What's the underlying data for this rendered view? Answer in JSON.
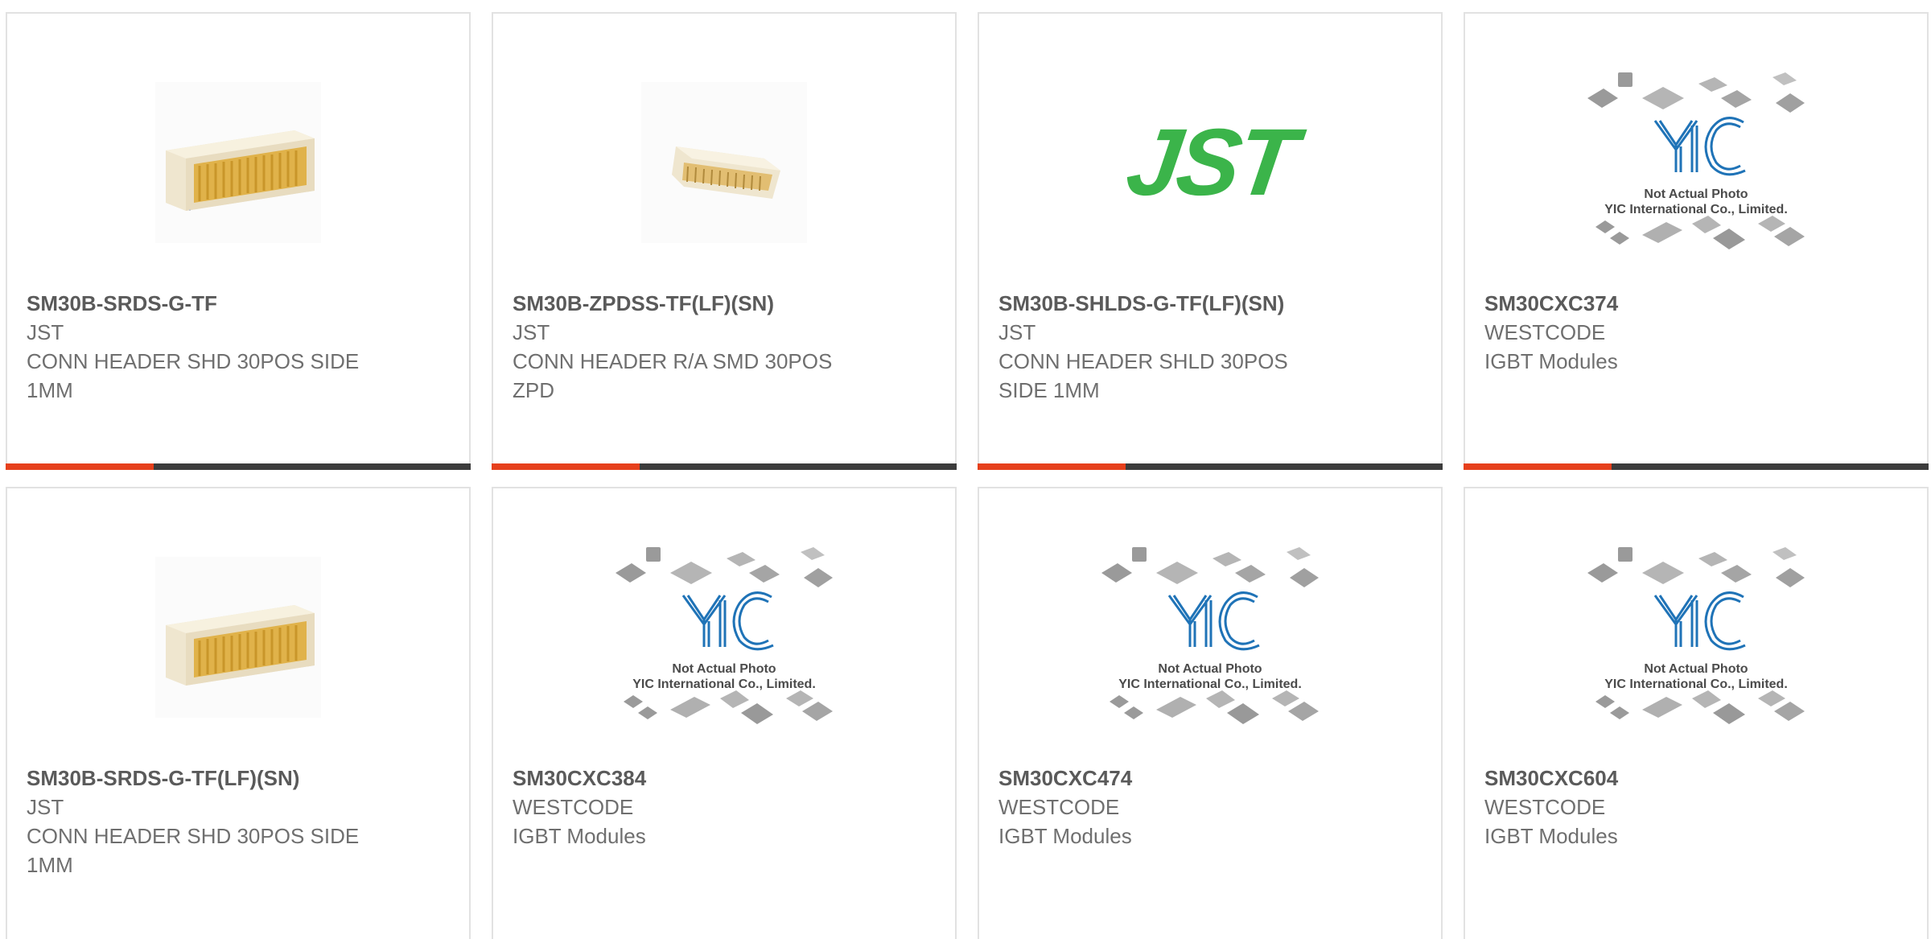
{
  "products": [
    {
      "part": "SM30B-SRDS-G-TF",
      "manufacturer": "JST",
      "description": "CONN HEADER SHD 30POS SIDE 1MM",
      "image": "connector-photo"
    },
    {
      "part": "SM30B-ZPDSS-TF(LF)(SN)",
      "manufacturer": "JST",
      "description": "CONN HEADER R/A SMD 30POS ZPD",
      "image": "connector-photo-small"
    },
    {
      "part": "SM30B-SHLDS-G-TF(LF)(SN)",
      "manufacturer": "JST",
      "description": "CONN HEADER SHLD 30POS SIDE 1MM",
      "image": "jst-logo"
    },
    {
      "part": "SM30CXC374",
      "manufacturer": "WESTCODE",
      "description": "IGBT Modules",
      "image": "yic-placeholder"
    },
    {
      "part": "SM30B-SRDS-G-TF(LF)(SN)",
      "manufacturer": "JST",
      "description": "CONN HEADER SHD 30POS SIDE 1MM",
      "image": "connector-photo"
    },
    {
      "part": "SM30CXC384",
      "manufacturer": "WESTCODE",
      "description": "IGBT Modules",
      "image": "yic-placeholder"
    },
    {
      "part": "SM30CXC474",
      "manufacturer": "WESTCODE",
      "description": "IGBT Modules",
      "image": "yic-placeholder"
    },
    {
      "part": "SM30CXC604",
      "manufacturer": "WESTCODE",
      "description": "IGBT Modules",
      "image": "yic-placeholder"
    }
  ],
  "jst_logo_text": "JST",
  "yic": {
    "logo_text": "YIC",
    "line1": "Not Actual Photo",
    "line2": "YIC International Co., Limited."
  },
  "colors": {
    "accent": "#e6401c",
    "bar": "#3c3c3c",
    "jst_green": "#3bb44a",
    "yic_blue": "#1f73b7"
  }
}
